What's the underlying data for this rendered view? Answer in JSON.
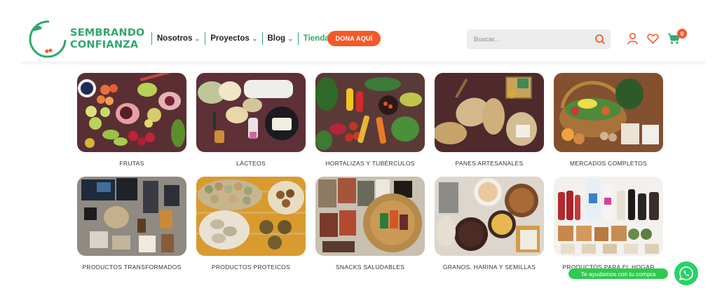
{
  "brand": {
    "name_line1": "SEMBRANDO",
    "name_line2": "CONFIANZA"
  },
  "nav": {
    "items": [
      {
        "label": "Nosotros",
        "active": false
      },
      {
        "label": "Proyectos",
        "active": false
      },
      {
        "label": "Blog",
        "active": false
      },
      {
        "label": "Tienda",
        "active": true
      }
    ],
    "donate_label": "DONA AQUÍ"
  },
  "search": {
    "placeholder": "Buscar...",
    "value": ""
  },
  "header_icons": [
    "user-icon",
    "heart-icon",
    "cart-icon"
  ],
  "cart": {
    "count": "0"
  },
  "categories": [
    {
      "label": "FRUTAS"
    },
    {
      "label": "LÁCTEOS"
    },
    {
      "label": "HORTALIZAS Y TUBÉRCULOS"
    },
    {
      "label": "PANES ARTESANALES"
    },
    {
      "label": "MERCADOS COMPLETOS"
    },
    {
      "label": "PRODUCTOS TRANSFORMADOS"
    },
    {
      "label": "PRODUCTOS PROTEICOS"
    },
    {
      "label": "SNACKS SALUDABLES"
    },
    {
      "label": "GRANOS, HARINA Y SEMILLAS"
    },
    {
      "label": "PRODUCTOS PARA EL HOGAR"
    }
  ],
  "whatsapp": {
    "bubble_text": "Te ayudamos con tu compra"
  },
  "colors": {
    "brand_green": "#2fa86b",
    "accent_orange": "#f25a2a",
    "whatsapp_green": "#25d366"
  }
}
